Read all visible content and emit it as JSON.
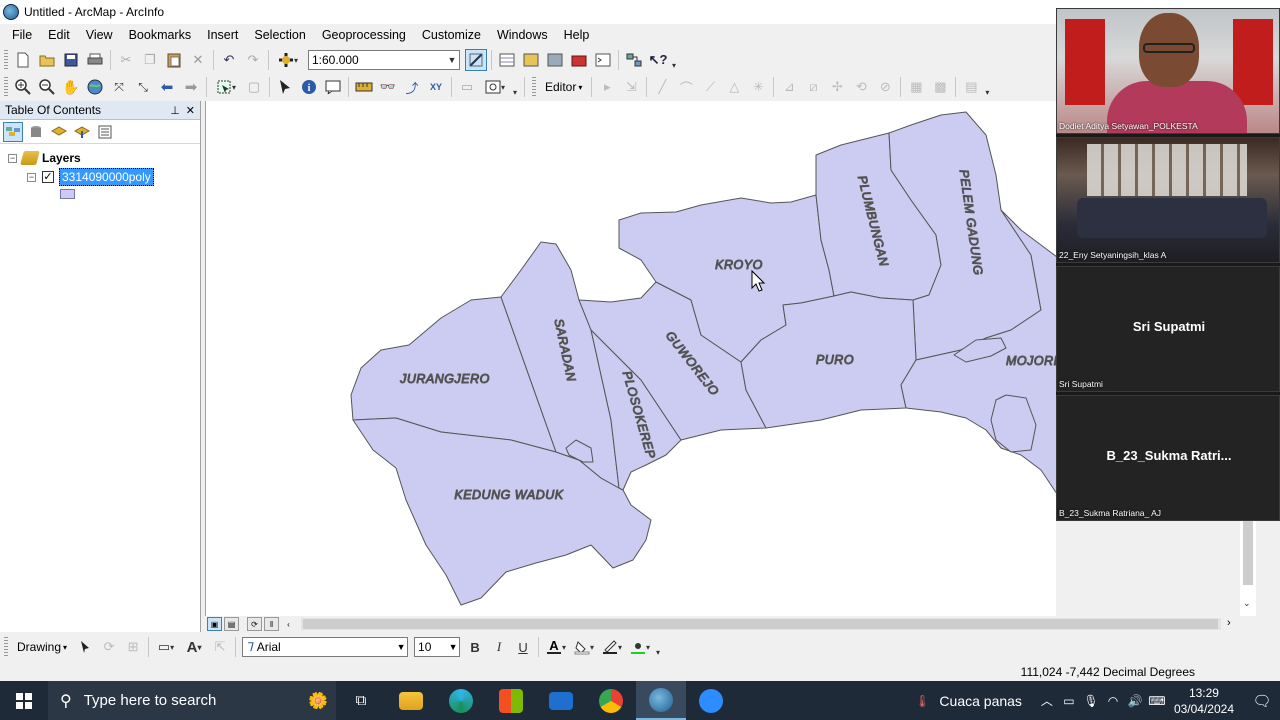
{
  "window": {
    "title": "Untitled - ArcMap - ArcInfo"
  },
  "menu": [
    "File",
    "Edit",
    "View",
    "Bookmarks",
    "Insert",
    "Selection",
    "Geoprocessing",
    "Customize",
    "Windows",
    "Help"
  ],
  "toolbar": {
    "scale_value": "1:60.000",
    "editor_label": "Editor"
  },
  "toc": {
    "title": "Table Of Contents",
    "root_label": "Layers",
    "layer_name": "3314090000poly",
    "layer_checked": true
  },
  "map": {
    "labels": [
      "KROYO",
      "PLUMBUNGAN",
      "PELEM GADUNG",
      "SARADAN",
      "GUWOREJO",
      "PURO",
      "MOJORE",
      "JURANGJERO",
      "PLOSOKEREP",
      "KEDUNG WADUK"
    ],
    "fill_color": "#ccccf2",
    "stroke_color": "#555555"
  },
  "drawing": {
    "label": "Drawing",
    "font_name": "Arial",
    "font_size": "10",
    "bold": "B",
    "italic": "I",
    "underline": "U",
    "text_tool": "A"
  },
  "status": {
    "coordinates": "111,024  -7,442 Decimal Degrees"
  },
  "zoom": {
    "participants": [
      {
        "name": "Dodiet Aditya Setyawan_POLKESTA",
        "display": ""
      },
      {
        "name": "22_Eny Setyaningsih_klas A",
        "display": ""
      },
      {
        "name": "Sri Supatmi",
        "display": "Sri Supatmi"
      },
      {
        "name": "B_23_Sukma Ratriana_ AJ",
        "display": "B_23_Sukma  Ratri..."
      }
    ]
  },
  "taskbar": {
    "search_placeholder": "Type here to search",
    "weather": "Cuaca panas",
    "time": "13:29",
    "date": "03/04/2024"
  }
}
